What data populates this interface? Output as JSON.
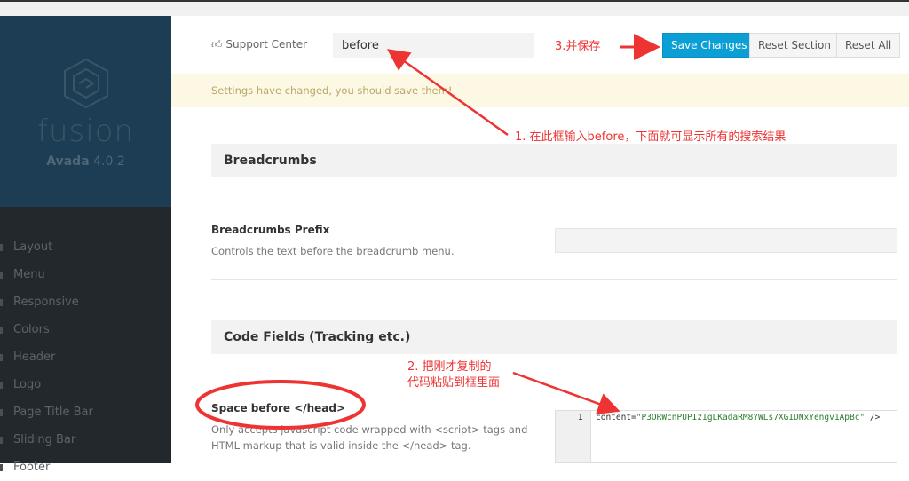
{
  "sidebar": {
    "logo_text": "fusion",
    "product": "Avada",
    "version": "4.0.2",
    "items": [
      {
        "label": "Layout"
      },
      {
        "label": "Menu"
      },
      {
        "label": "Responsive"
      },
      {
        "label": "Colors"
      },
      {
        "label": "Header"
      },
      {
        "label": "Logo"
      },
      {
        "label": "Page Title Bar"
      },
      {
        "label": "Sliding Bar"
      },
      {
        "label": "Footer"
      }
    ]
  },
  "header": {
    "support_label": "Support Center",
    "search_value": "before",
    "save_label": "Save Changes",
    "reset_section_label": "Reset Section",
    "reset_all_label": "Reset All",
    "primary_color": "#0c9fd6"
  },
  "notice": "Settings have changed, you should save them!",
  "sections": [
    {
      "title": "Breadcrumbs",
      "fields": [
        {
          "label": "Breadcrumbs Prefix",
          "description": "Controls the text before the breadcrumb menu.",
          "value": ""
        }
      ]
    },
    {
      "title": "Code Fields (Tracking etc.)",
      "fields": [
        {
          "label": "Space before </head>",
          "description": "Only accepts javascript code wrapped with <script> tags and HTML markup that is valid inside the </head> tag.",
          "line_number": "1",
          "code_attr": "content=",
          "code_string": "\"P3ORWcnPUPIzIgLKadaRM8YWLs7XGIDNxYengv1ApBc\"",
          "code_tail": " />"
        }
      ]
    }
  ],
  "annotations": {
    "step1": "1. 在此框输入before，下面就可显示所有的搜索结果",
    "step2_line1": "2. 把刚才复制的",
    "step2_line2": "代码粘贴到框里面",
    "step3": "3.并保存",
    "color": "#ee3333"
  }
}
